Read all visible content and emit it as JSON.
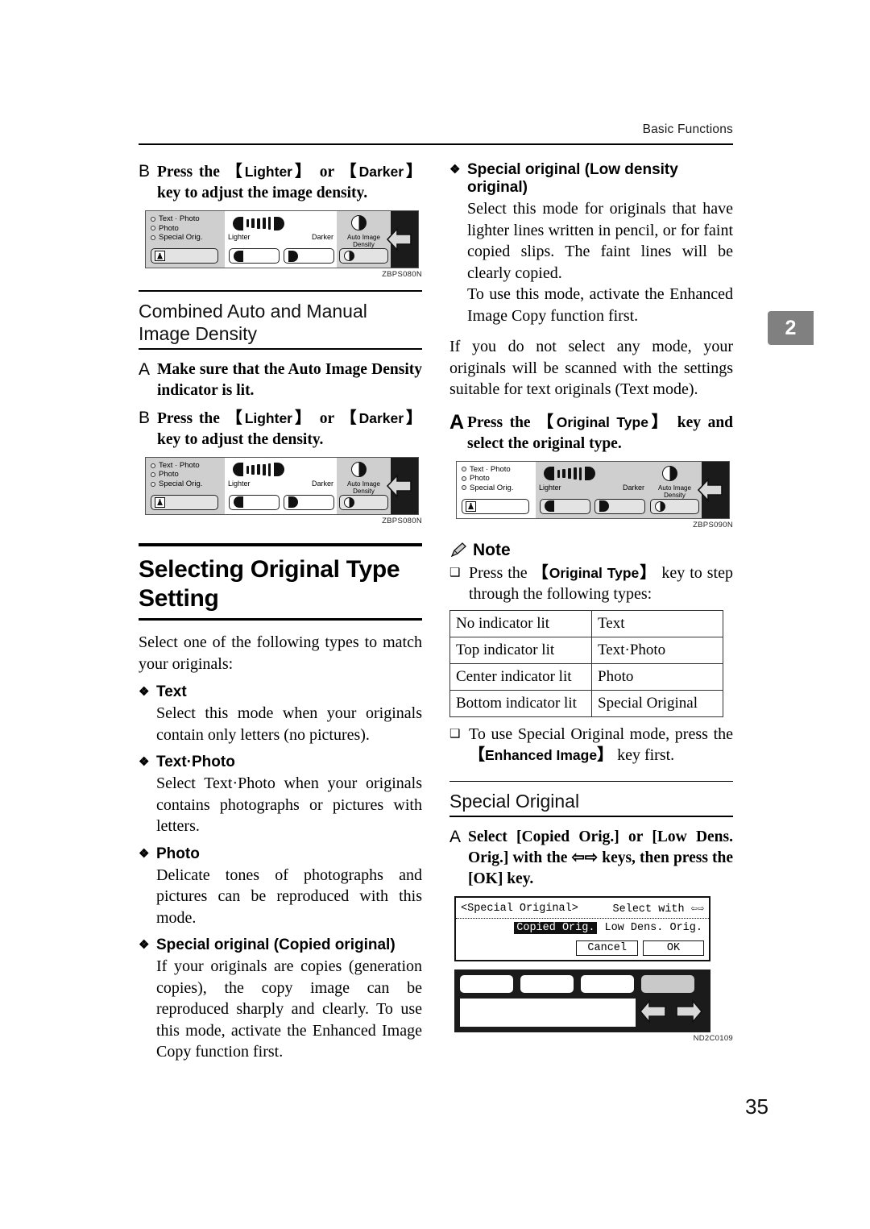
{
  "header": {
    "running_head": "Basic Functions"
  },
  "chapter_tab": {
    "number": "2"
  },
  "page_number": "35",
  "left_column": {
    "step_b_density": {
      "letter": "B",
      "text_pre": "Press the ",
      "key1": "Lighter",
      "text_mid": " or ",
      "key2": "Darker",
      "text_post": " key to adjust the image density."
    },
    "figure_1": {
      "id": "ZBPS080N"
    },
    "section_combined": {
      "title": "Combined Auto and Manual Image Density",
      "step_a": {
        "letter": "A",
        "text": "Make sure that the Auto Image Density indicator is lit."
      },
      "step_b": {
        "letter": "B",
        "text_pre": "Press the ",
        "key1": "Lighter",
        "text_mid": " or ",
        "key2": "Darker",
        "text_post": " key to adjust the density."
      },
      "figure_2": {
        "id": "ZBPS080N"
      }
    },
    "main_heading": "Selecting Original Type Setting",
    "intro": "Select one of the following types to match your originals:",
    "types": [
      {
        "name": "Text",
        "description": "Select this mode when your originals contain only letters (no pictures)."
      },
      {
        "name": "Text·Photo",
        "description": "Select Text·Photo when your originals contains photographs or pictures with letters."
      },
      {
        "name": "Photo",
        "description": "Delicate tones of photographs and pictures can be reproduced with this mode."
      },
      {
        "name": "Special original (Copied original)",
        "description": "If your originals are copies (generation copies), the copy image can be reproduced sharply and clearly. To use this mode, activate the Enhanced Image Copy function first."
      }
    ]
  },
  "right_column": {
    "type_low_density": {
      "name": "Special original (Low density original)",
      "description": "Select this mode for originals that have lighter lines written in pencil, or for faint copied slips. The faint lines will be clearly copied.",
      "description2": "To use this mode, activate the Enhanced Image Copy function first."
    },
    "default_note": "If you do not select any mode, your originals will be scanned with the settings suitable for text originals (Text mode).",
    "step_a_original_type": {
      "letter": "A",
      "text_pre": "Press the ",
      "key1": "Original Type",
      "text_post": " key and select the original type."
    },
    "figure_3": {
      "id": "ZBPS090N"
    },
    "note": {
      "label": "Note",
      "items": [
        {
          "text_pre": "Press the ",
          "key1": "Original Type",
          "text_post": " key to step through the following types:"
        },
        {
          "text_pre": "To use Special Original mode, press the ",
          "key1": "Enhanced Image",
          "text_post": " key first."
        }
      ]
    },
    "indicator_table": {
      "rows": [
        {
          "indicator": "No indicator lit",
          "type": "Text"
        },
        {
          "indicator": "Top indicator lit",
          "type": "Text·Photo"
        },
        {
          "indicator": "Center indicator lit",
          "type": "Photo"
        },
        {
          "indicator": "Bottom indicator lit",
          "type": "Special Original"
        }
      ]
    },
    "section_special_original": {
      "title": "Special Original",
      "step_a": {
        "letter": "A",
        "text_pre": "Select [Copied Orig.] or [Low Dens. Orig.] with the ",
        "arrows": "⇦⇨",
        "text_post": " keys, then press the [OK] key."
      }
    },
    "lcd_screen": {
      "title": "<Special Original>",
      "hint": "Select with",
      "option_selected": "Copied Orig.",
      "option_other": "Low Dens. Orig.",
      "cancel": "Cancel",
      "ok": "OK"
    },
    "figure_4": {
      "id": "ND2C0109"
    }
  },
  "panel_figure": {
    "indicators": [
      "Text · Photo",
      "Photo",
      "Special  Orig."
    ],
    "lighter_label": "Lighter",
    "darker_label": "Darker",
    "auto_label": "Auto Image Density"
  },
  "colors": {
    "panel_bg": "#cfcfcf",
    "panel_lit": "#ffffff",
    "panel_dark": "#1b1b1b",
    "tab_gray": "#808080"
  }
}
